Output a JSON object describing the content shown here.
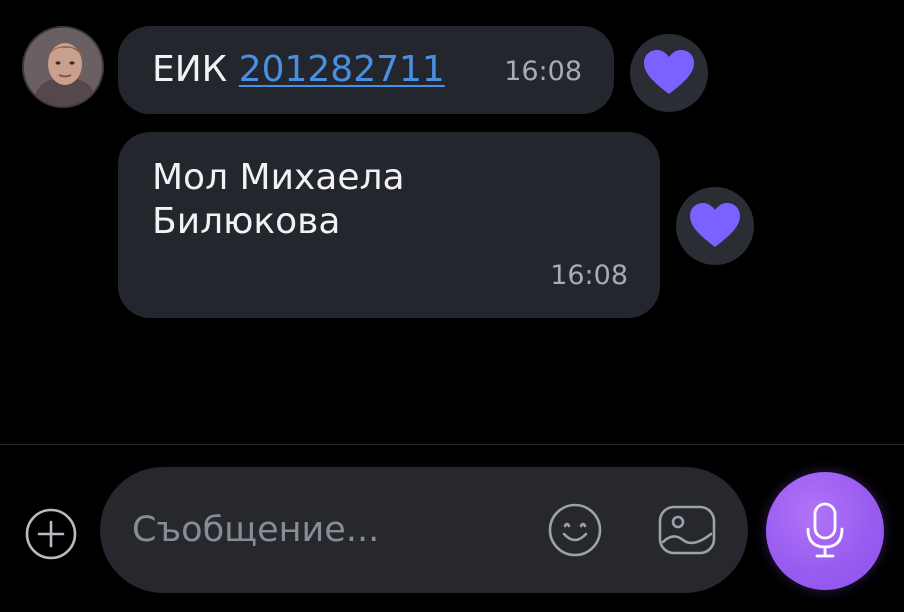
{
  "contact": {
    "avatar_alt": "contact-photo"
  },
  "messages": [
    {
      "prefix": "ЕИК ",
      "link": "201282711",
      "time": "16:08",
      "reaction": "heart"
    },
    {
      "line1": "Мол Михаела",
      "line2": "Билюкова",
      "time": "16:08",
      "reaction": "heart"
    }
  ],
  "composer": {
    "placeholder": "Съобщение...",
    "value": ""
  },
  "colors": {
    "background": "#000000",
    "bubble": "#24262d",
    "link": "#4a90e2",
    "heart": "#7b61ff",
    "mic_button": "#9a5cf0"
  },
  "icons": {
    "add": "plus-circle-icon",
    "emoji": "smiley-icon",
    "gallery": "image-icon",
    "mic": "microphone-icon",
    "reaction": "heart-icon"
  }
}
